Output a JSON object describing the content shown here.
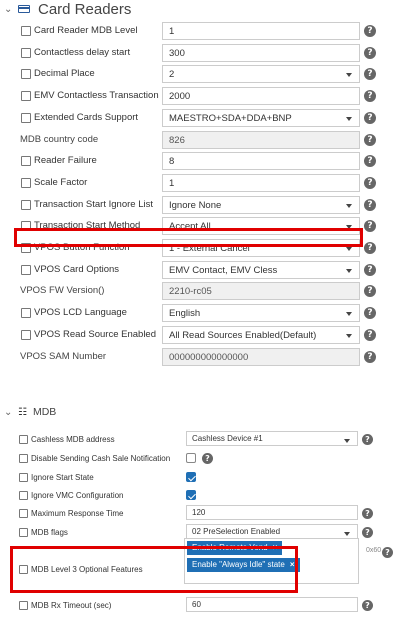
{
  "card_readers": {
    "title": "Card Readers",
    "rows": [
      {
        "label": "Card Reader MDB Level",
        "value": "1",
        "checkbox": true,
        "kind": "text"
      },
      {
        "label": "Contactless delay start",
        "value": "300",
        "checkbox": true,
        "kind": "text"
      },
      {
        "label": "Decimal Place",
        "value": "2",
        "checkbox": true,
        "kind": "select"
      },
      {
        "label": "EMV Contactless Transaction Limit",
        "value": "2000",
        "checkbox": true,
        "kind": "text"
      },
      {
        "label": "Extended Cards Support",
        "value": "MAESTRO+SDA+DDA+BNP",
        "checkbox": true,
        "kind": "select"
      },
      {
        "label": "MDB country code",
        "value": "826",
        "checkbox": false,
        "kind": "readonly"
      },
      {
        "label": "Reader Failure",
        "value": "8",
        "checkbox": true,
        "kind": "text"
      },
      {
        "label": "Scale Factor",
        "value": "1",
        "checkbox": true,
        "kind": "text"
      },
      {
        "label": "Transaction Start Ignore List",
        "value": "Ignore None",
        "checkbox": true,
        "kind": "select"
      },
      {
        "label": "Transaction Start Method",
        "value": "Accept All",
        "checkbox": true,
        "kind": "select"
      },
      {
        "label": "VPOS Button Function",
        "value": "1 - External Cancel",
        "checkbox": true,
        "kind": "select"
      },
      {
        "label": "VPOS Card Options",
        "value": "EMV Contact, EMV Cless",
        "checkbox": true,
        "kind": "select"
      },
      {
        "label": "VPOS FW Version()",
        "value": "2210-rc05",
        "checkbox": false,
        "kind": "readonly"
      },
      {
        "label": "VPOS LCD Language",
        "value": "English",
        "checkbox": true,
        "kind": "select"
      },
      {
        "label": "VPOS Read Source Enabled",
        "value": "All Read Sources Enabled(Default)",
        "checkbox": true,
        "kind": "select"
      },
      {
        "label": "VPOS SAM Number",
        "value": "000000000000000",
        "checkbox": false,
        "kind": "readonly"
      }
    ]
  },
  "mdb": {
    "title": "MDB",
    "rows": [
      {
        "label": "Cashless MDB address",
        "value": "Cashless Device #1",
        "kind": "select"
      },
      {
        "label": "Disable Sending Cash Sale Notification",
        "kind": "toggle",
        "checked": false
      },
      {
        "label": "Ignore Start State",
        "kind": "toggle",
        "checked": true
      },
      {
        "label": "Ignore VMC Configuration",
        "kind": "toggle",
        "checked": true
      },
      {
        "label": "Maximum Response Time",
        "value": "120",
        "kind": "text"
      },
      {
        "label": "MDB flags",
        "value": "02 PreSelection Enabled",
        "kind": "select"
      },
      {
        "label": "MDB Level 3 Optional Features",
        "kind": "tags"
      },
      {
        "label": "MDB Rx Timeout (sec)",
        "value": "60",
        "kind": "text"
      }
    ],
    "tags": [
      "Enable Remote Vend",
      "Enable \"Always Idle\" state"
    ],
    "tag_note": "0x60"
  },
  "icons": {
    "help": "help-circle-icon",
    "card": "card-reader-icon",
    "mdb": "mdb-network-icon",
    "collapse": "chevron-down-icon"
  },
  "colors": {
    "highlight": "#e00000",
    "tag": "#1f6fb5"
  }
}
